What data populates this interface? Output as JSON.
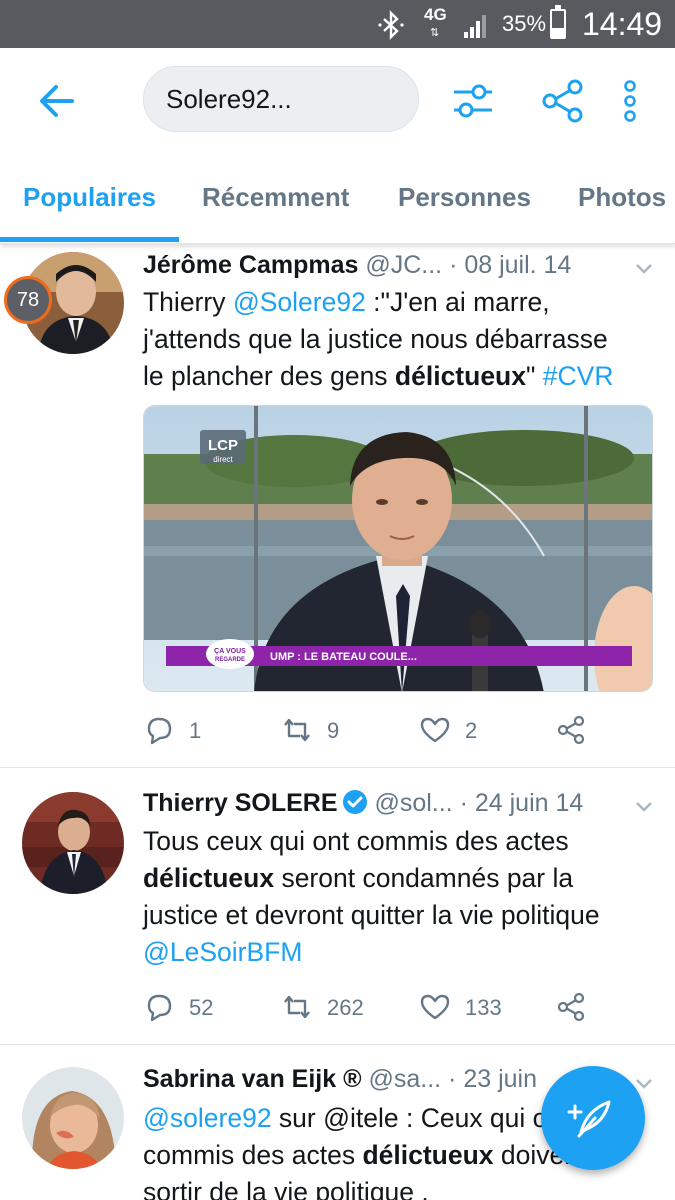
{
  "status_bar": {
    "network": "4G",
    "battery": "35%",
    "battery_level": 0.35,
    "time": "14:49",
    "icons": [
      "bluetooth-icon",
      "signal-icon",
      "battery-icon"
    ]
  },
  "search": {
    "query": "Solere92..."
  },
  "toolbar_icons": [
    "back-arrow-icon",
    "filter-icon",
    "share-icon",
    "more-vertical-icon"
  ],
  "tabs": [
    {
      "label": "Populaires",
      "active": true
    },
    {
      "label": "Récemment",
      "active": false
    },
    {
      "label": "Personnes",
      "active": false
    },
    {
      "label": "Photos",
      "active": false
    }
  ],
  "tweets": [
    {
      "rank": "78",
      "name": "Jérôme Campmas",
      "handle": "@JC...",
      "date": "· 08 juil. 14",
      "text": {
        "line1_pre": "Thierry ",
        "mention": "@Solere92",
        "line1_post": " :\"J'en ai marre,",
        "line2": "j'attends que la justice nous débarrasse",
        "line3_pre": "le plancher des gens ",
        "bold": "délictueux",
        "line3_post": "\" ",
        "hashtag": "#CVR"
      },
      "media": {
        "channel_logo": "LCP",
        "channel_sub": "direct",
        "show_logo_1": "ÇA VOUS",
        "show_logo_2": "REGARDE",
        "banner": "UMP : LE BATEAU COULE..."
      },
      "replies": "1",
      "retweets": "9",
      "likes": "2"
    },
    {
      "name": "Thierry SOLERE",
      "verified": true,
      "handle": "@sol...",
      "date": "· 24 juin 14",
      "text": {
        "line1": "Tous ceux qui ont commis des actes",
        "line2_bold": "délictueux",
        "line2_post": " seront condamnés par la",
        "line3": "justice et devront quitter la vie politique",
        "mention": "@LeSoirBFM"
      },
      "replies": "52",
      "retweets": "262",
      "likes": "133"
    },
    {
      "name": "Sabrina van Eijk ®",
      "handle": "@sa...",
      "date": "· 23 juin",
      "text": {
        "mention": "@solere92",
        "line1_post": " sur @itele : Ceux qui ont",
        "line2_pre": "commis des actes ",
        "line2_bold": "délictueux",
        "line2_post": " doivent",
        "line3": "sortir de la vie politique ."
      }
    }
  ],
  "colors": {
    "accent": "#1da1f2",
    "status_bar": "#575b5f",
    "secondary_text": "#657786",
    "banner_purple": "#8e24aa"
  }
}
